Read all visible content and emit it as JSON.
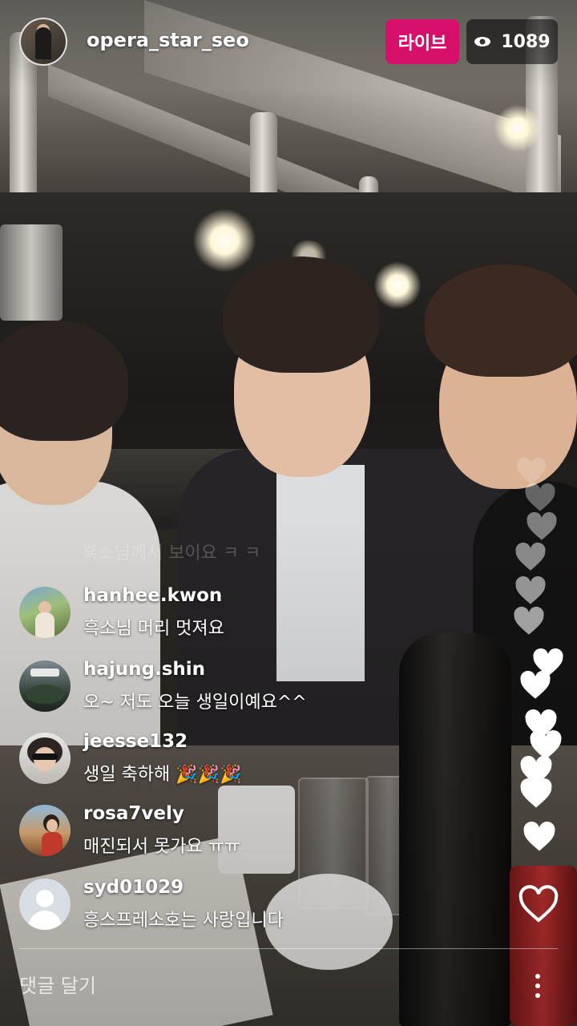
{
  "header": {
    "username": "opera_star_seo",
    "live_label": "라이브",
    "viewer_count": "1089",
    "viewer_icon": "eye-icon"
  },
  "faded_comment": "흑소님께서 보이요 ㅋ ㅋ",
  "comments": [
    {
      "username": "hanhee.kwon",
      "text": "흑소님 머리 멋져요",
      "avatar": "photo"
    },
    {
      "username": "hajung.shin",
      "text": "오~ 저도 오늘 생일이예요^^",
      "avatar": "photo"
    },
    {
      "username": "jeesse132",
      "text": "생일 축하해 🎉🎉🎉",
      "avatar": "photo"
    },
    {
      "username": "rosa7vely",
      "text": "매진되서 못가요 ㅠㅠ",
      "avatar": "photo"
    },
    {
      "username": "syd01029",
      "text": "흥스프레소호는 사랑입니다",
      "avatar": "default-avatar"
    }
  ],
  "footer": {
    "comment_placeholder": "댓글 달기",
    "like_icon": "heart-outline-icon",
    "more_icon": "more-vertical-icon"
  },
  "colors": {
    "live_badge": "#d6106a",
    "viewer_badge": "rgba(0,0,0,0.55)",
    "text": "#ffffff"
  }
}
